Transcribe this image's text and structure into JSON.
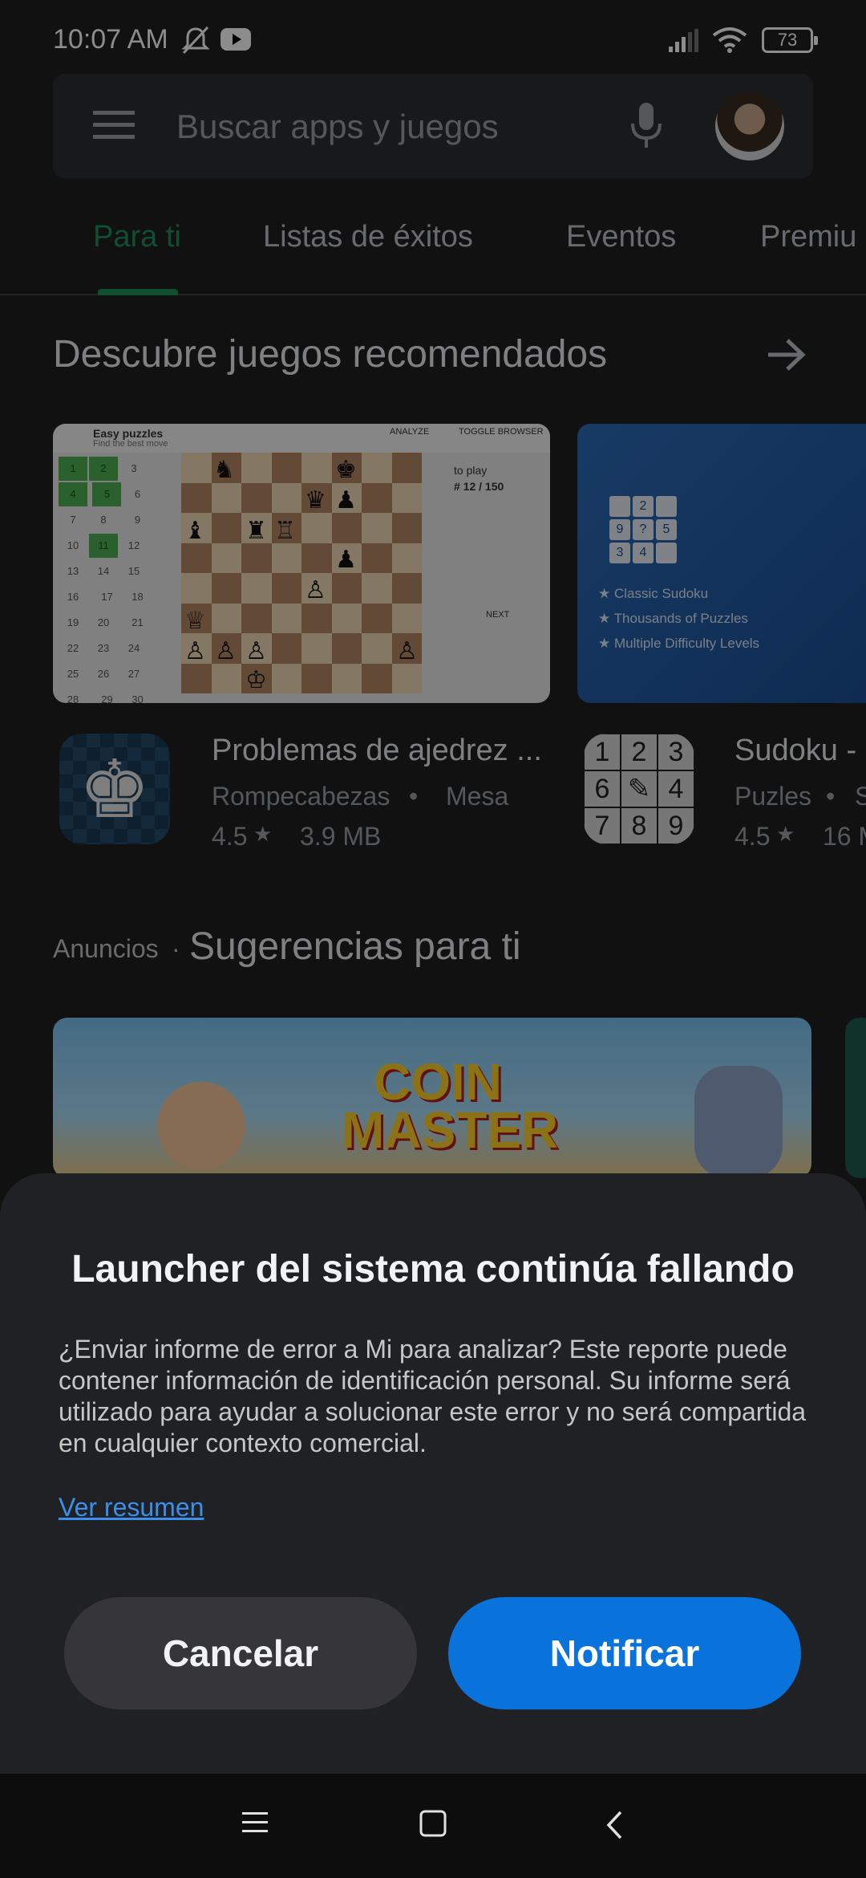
{
  "status_bar": {
    "time": "10:07 AM",
    "battery": "73",
    "icons": [
      "mute-notifications-icon",
      "youtube-icon",
      "signal-icon",
      "wifi-icon",
      "battery-icon"
    ]
  },
  "search": {
    "placeholder": "Buscar apps y juegos",
    "icons": [
      "menu-icon",
      "mic-icon",
      "avatar"
    ]
  },
  "tabs": [
    {
      "label": "Para ti",
      "active": true
    },
    {
      "label": "Listas de éxitos",
      "active": false
    },
    {
      "label": "Eventos",
      "active": false
    },
    {
      "label": "Premiu",
      "active": false
    }
  ],
  "section_recommended": {
    "title": "Descubre juegos recomendados",
    "chess_banner": {
      "header_title": "Easy puzzles",
      "header_sub": "Find the best move",
      "analyze": "ANALYZE",
      "toggle": "TOGGLE BROWSER",
      "to_play": "to play",
      "counter": "# 12 / 150",
      "next": "NEXT"
    },
    "sudoku_banner": {
      "features": [
        "★ Classic Sudoku",
        "★ Thousands of Puzzles",
        "★ Multiple Difficulty Levels"
      ]
    },
    "apps": [
      {
        "title": "Problemas de ajedrez ...",
        "category": "Rompecabezas",
        "subcategory": "Mesa",
        "rating": "4.5",
        "size": "3.9 MB"
      },
      {
        "title": "Sudoku -",
        "category": "Puzles",
        "subcategory": "S",
        "rating": "4.5",
        "size": "16 M"
      }
    ]
  },
  "section_ads": {
    "label": "Anuncios",
    "separator": "·",
    "title": "Sugerencias para ti",
    "banner_title_1": "COIN",
    "banner_title_2": "MASTER"
  },
  "dialog": {
    "title": "Launcher del sistema continúa fallando",
    "body": "¿Enviar informe de error a Mi para analizar? Este reporte puede contener información de identificación personal. Su informe será utilizado para ayudar a solucionar este error y no será compartida en cualquier contexto comercial.",
    "link": "Ver resumen",
    "cancel": "Cancelar",
    "notify": "Notificar"
  },
  "colors": {
    "accent_green": "#1e8e5a",
    "primary_blue": "#0a73db",
    "link_blue": "#3b8eea"
  }
}
